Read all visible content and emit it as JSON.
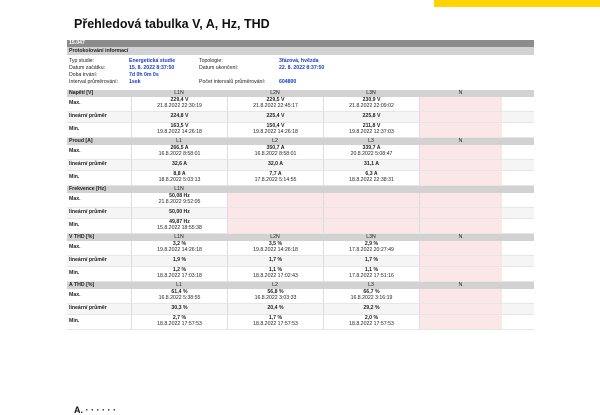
{
  "page": {
    "title": "Přehledová tabulka V, A, Hz, THD",
    "trailing_text": "A. ·  · ·  ·  · ·",
    "accent_color": "#ffd400"
  },
  "report": {
    "id": "15.047",
    "protocol_header": "Protokolování informací",
    "info_left_labels": [
      "Typ studie:",
      "Datum začátku:",
      "Doba trvání:",
      "Interval průměrování:"
    ],
    "info_left_values": [
      "Energetická studie",
      "15. 8. 2022 8:37:50",
      "7d 0h 0m 0s",
      "1sek"
    ],
    "info_right_labels": [
      "Topologie:",
      "Datum ukončení:",
      "",
      "Počet intervalů průměrování:"
    ],
    "info_right_values": [
      "3fázová, hvězda",
      "22. 8. 2022 8:37:50",
      "",
      "604800"
    ]
  },
  "sections": [
    {
      "label": "Napětí [V]",
      "channels": [
        "L1N",
        "L2N",
        "L3N",
        "N"
      ],
      "rows": [
        {
          "label": "Max.",
          "cells": [
            [
              "229,4 V",
              "21.8.2022 22:30:19"
            ],
            [
              "229,5 V",
              "21.8.2022 22:45:17"
            ],
            [
              "230,9 V",
              "21.8.2022 22:09:02"
            ],
            null
          ]
        },
        {
          "label": "lineární průměr",
          "cells": [
            [
              "224,8 V",
              ""
            ],
            [
              "225,4 V",
              ""
            ],
            [
              "225,8 V",
              ""
            ],
            null
          ]
        },
        {
          "label": "Min.",
          "cells": [
            [
              "163,5 V",
              "19.8.2022 14:26:18"
            ],
            [
              "150,4 V",
              "19.8.2022 14:26:18"
            ],
            [
              "211,8 V",
              "19.8.2022 12:37:03"
            ],
            null
          ]
        }
      ]
    },
    {
      "label": "Proud [A]",
      "channels": [
        "L1",
        "L2",
        "L3",
        "N"
      ],
      "rows": [
        {
          "label": "Max.",
          "cells": [
            [
              "266,5 A",
              "16.8.2022 8:58:01"
            ],
            [
              "350,7 A",
              "16.8.2022 8:58:01"
            ],
            [
              "339,7 A",
              "20.8.2022 5:08:47"
            ],
            null
          ]
        },
        {
          "label": "lineární průměr",
          "cells": [
            [
              "32,6 A",
              ""
            ],
            [
              "32,0 A",
              ""
            ],
            [
              "31,1 A",
              ""
            ],
            null
          ]
        },
        {
          "label": "Min.",
          "cells": [
            [
              "8,8 A",
              "18.8.2022 5:03:13"
            ],
            [
              "7,7 A",
              "17.8.2022 5:14:55"
            ],
            [
              "6,3 A",
              "18.8.2022 22:38:31"
            ],
            null
          ]
        }
      ]
    },
    {
      "label": "Frekvence [Hz]",
      "channels": [
        "L1N",
        "",
        "",
        ""
      ],
      "rows": [
        {
          "label": "Max.",
          "cells": [
            [
              "50,08 Hz",
              "21.8.2022 9:52:05"
            ],
            null,
            null,
            null
          ]
        },
        {
          "label": "lineární průměr",
          "cells": [
            [
              "50,00 Hz",
              ""
            ],
            null,
            null,
            null
          ]
        },
        {
          "label": "Min.",
          "cells": [
            [
              "49,87 Hz",
              "15.8.2022 18:55:38"
            ],
            null,
            null,
            null
          ]
        }
      ]
    },
    {
      "label": "V THD [%]",
      "channels": [
        "L1N",
        "L2N",
        "L3N",
        "N"
      ],
      "rows": [
        {
          "label": "Max.",
          "cells": [
            [
              "3,2 %",
              "19.8.2022 14:26:18"
            ],
            [
              "3,5 %",
              "19.8.2022 14:26:18"
            ],
            [
              "2,9 %",
              "17.8.2022 20:27:49"
            ],
            null
          ]
        },
        {
          "label": "lineární průměr",
          "cells": [
            [
              "1,9 %",
              ""
            ],
            [
              "1,7 %",
              ""
            ],
            [
              "1,7 %",
              ""
            ],
            null
          ]
        },
        {
          "label": "Min.",
          "cells": [
            [
              "1,2 %",
              "18.8.2022 17:03:18"
            ],
            [
              "1,1 %",
              "18.8.2022 17:02:43"
            ],
            [
              "1,1 %",
              "17.8.2022 17:51:16"
            ],
            null
          ]
        }
      ]
    },
    {
      "label": "A THD [%]",
      "channels": [
        "L1",
        "L2",
        "L3",
        "N"
      ],
      "rows": [
        {
          "label": "Max.",
          "cells": [
            [
              "61,4 %",
              "16.8.2022 5:38:55"
            ],
            [
              "56,8 %",
              "16.8.2022 3:03:33"
            ],
            [
              "66,7 %",
              "16.8.2022 3:16:19"
            ],
            null
          ]
        },
        {
          "label": "lineární průměr",
          "cells": [
            [
              "30,3 %",
              ""
            ],
            [
              "20,4 %",
              ""
            ],
            [
              "29,2 %",
              ""
            ],
            null
          ]
        },
        {
          "label": "Min.",
          "cells": [
            [
              "2,7 %",
              "18.8.2022 17:57:53"
            ],
            [
              "1,7 %",
              "18.8.2022 17:57:53"
            ],
            [
              "2,0 %",
              "18.8.2022 17:57:53"
            ],
            null
          ]
        }
      ]
    }
  ]
}
